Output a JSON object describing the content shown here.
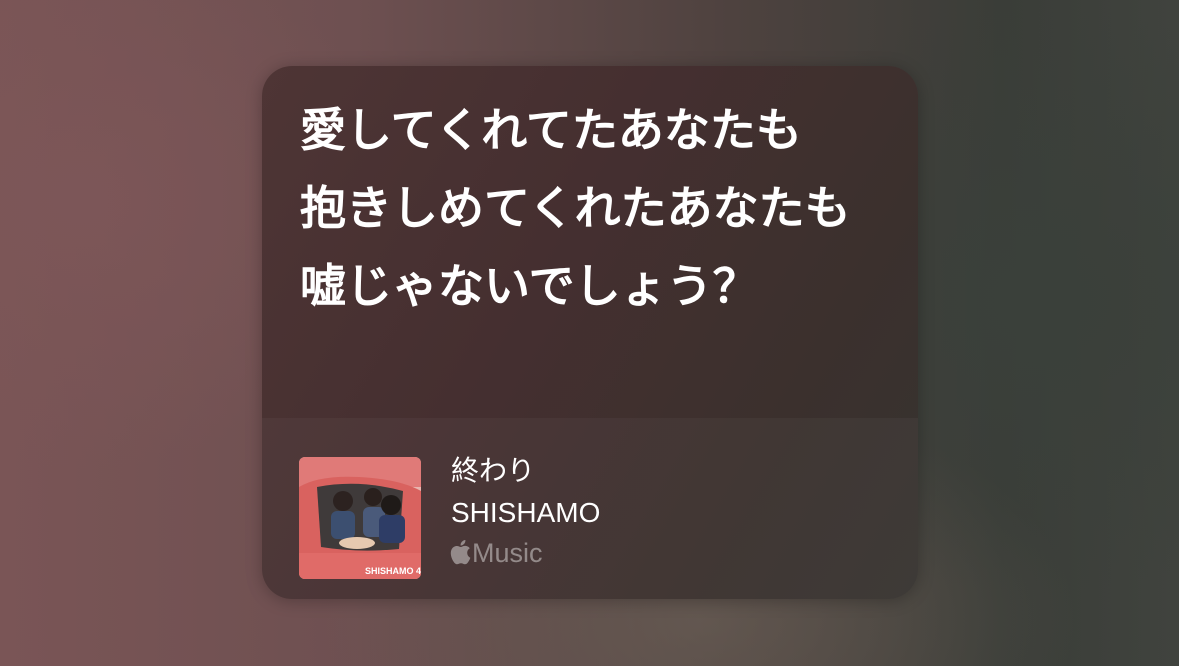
{
  "lyrics": {
    "lines": [
      "愛してくれてたあなたも",
      "抱きしめてくれたあなたも",
      "嘘じゃないでしょう？"
    ]
  },
  "track": {
    "title": "終わり",
    "artist": "SHISHAMO",
    "service_label": "Music",
    "service_icon": "apple-logo-icon",
    "artwork_text": "SHISHAMO 4"
  },
  "colors": {
    "card_background": "#4a3434",
    "text_primary": "#ffffff",
    "text_secondary": "#9a8c88"
  }
}
